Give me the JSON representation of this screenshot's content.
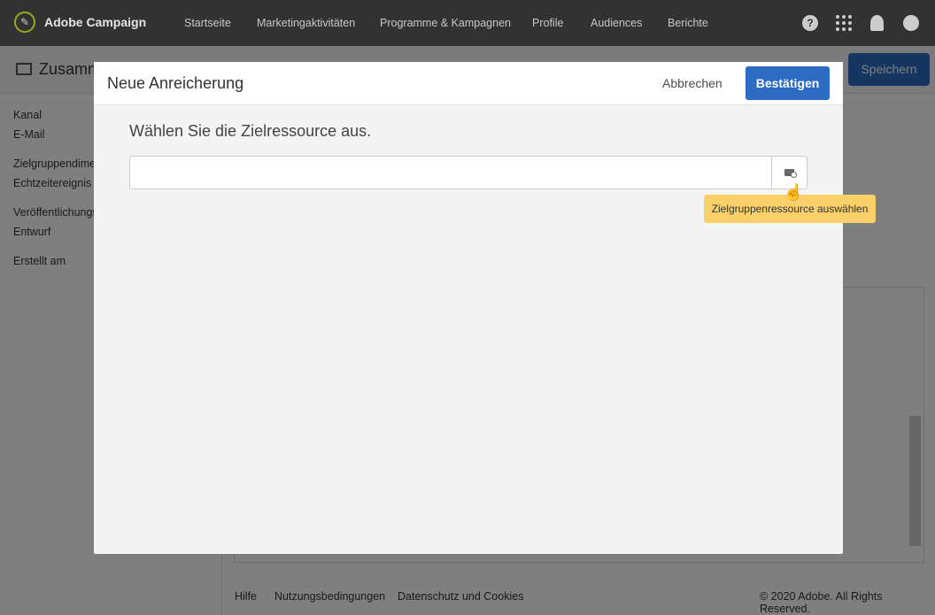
{
  "topbar": {
    "brand": "Adobe Campaign",
    "nav": [
      "Startseite",
      "Marketingaktivitäten",
      "Programme & Kampagnen",
      "Profile",
      "Audiences",
      "Berichte"
    ],
    "help": "?"
  },
  "page": {
    "title": "Zusamm",
    "save": "Speichern",
    "sidebar": [
      "Kanal",
      "E-Mail",
      "Zielgruppendime",
      "Echtzeitereignis",
      "Veröffentlichungs",
      "Entwurf",
      "Erstellt am"
    ]
  },
  "footer": {
    "links": [
      "Hilfe",
      "Nutzungsbedingungen",
      "Datenschutz und Cookies"
    ],
    "copyright": "© 2020 Adobe. All Rights Reserved."
  },
  "modal": {
    "title": "Neue Anreicherung",
    "cancel": "Abbrechen",
    "confirm": "Bestätigen",
    "prompt": "Wählen Sie die Zielressource aus.",
    "input_value": "",
    "tooltip": "Zielgruppenressource auswählen"
  }
}
